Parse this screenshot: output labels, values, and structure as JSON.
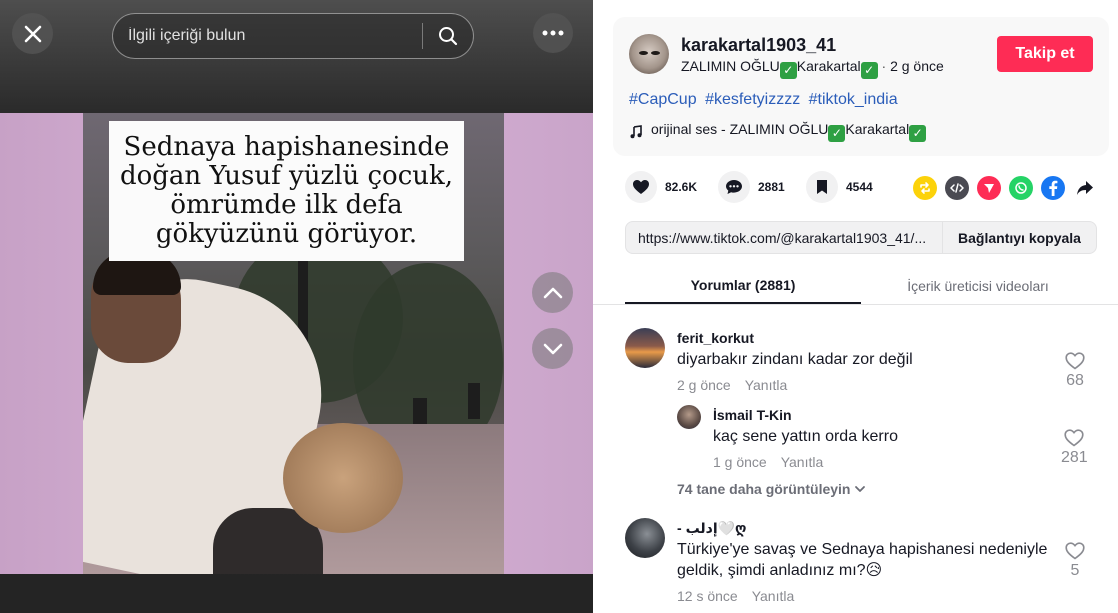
{
  "search": {
    "placeholder": "İlgili içeriği bulun"
  },
  "video": {
    "caption": "Sednaya hapishanesinde doğan Yusuf yüzlü çocuk, ömrümde ilk defa gökyüzünü görüyor."
  },
  "author": {
    "username": "karakartal1903_41",
    "nickname_part1": "ZALIMIN OĞLU",
    "nickname_part2": "Karakartal",
    "time": "2 g önce",
    "follow_label": "Takip et"
  },
  "hashtags": [
    "#CapCup",
    "#kesfetyizzzz",
    "#tiktok_india"
  ],
  "music": {
    "part1": "orijinal ses - ZALIMIN OĞLU",
    "part2": "Karakartal"
  },
  "stats": {
    "likes": "82.6K",
    "comments": "2881",
    "saves": "4544"
  },
  "share_icons": [
    "repost-icon",
    "embed-icon",
    "send-icon",
    "whatsapp-icon",
    "facebook-icon",
    "share-arrow-icon"
  ],
  "link": {
    "url": "https://www.tiktok.com/@karakartal1903_41/...",
    "copy_label": "Bağlantıyı kopyala"
  },
  "tabs": [
    {
      "label": "Yorumlar (2881)",
      "active": true
    },
    {
      "label": "İçerik üreticisi videoları",
      "active": false
    }
  ],
  "comments": [
    {
      "user": "ferit_korkut",
      "text": "diyarbakır zindanı kadar zor değil",
      "time": "2 g önce",
      "reply_label": "Yanıtla",
      "likes": "68"
    },
    {
      "user": "İsmail T-Kin",
      "text": "kaç sene yattın orda kerro",
      "time": "1 g önce",
      "reply_label": "Yanıtla",
      "likes": "281"
    },
    {
      "user": "- إدلب🤍ღ",
      "text": "Türkiye'ye savaş ve Sednaya hapishanesi nedeniyle geldik, şimdi anladınız mı?😥",
      "time": "12 s önce",
      "reply_label": "Yanıtla",
      "likes": "5"
    }
  ],
  "view_more": "74 tane daha görüntüleyin",
  "colors": {
    "accent": "#fe2c55",
    "hashtag": "#2b5db9",
    "check": "#2ea043"
  }
}
